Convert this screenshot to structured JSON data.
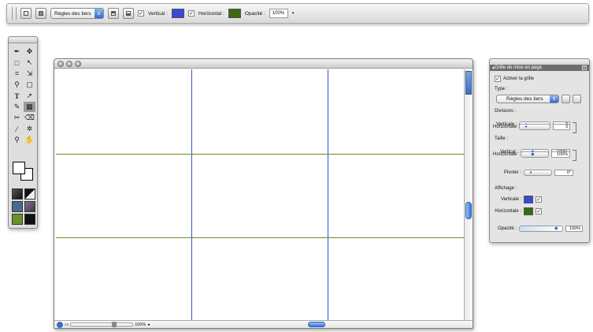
{
  "toolbar": {
    "preset_value": "Règles des tiers",
    "vertical_label": "Vertical :",
    "vertical_checked": true,
    "vertical_color": "#3b48d8",
    "horizontal_label": "Horizontal :",
    "horizontal_checked": true,
    "horizontal_color": "#3a6b12",
    "opacity_label": "Opacité :",
    "opacity_value": "100%"
  },
  "tools": {
    "items": [
      "pen-tool-icon",
      "move-icon",
      "marquee-icon",
      "selection-icon",
      "crop-icon",
      "transform-icon",
      "brush-icon",
      "rect-shape-icon",
      "text-icon",
      "arrow-icon",
      "zoom-blur-icon",
      "gradient-icon",
      "clone-icon",
      "eraser-icon",
      "dropper-icon",
      "hand-wheel-icon",
      "magnify-icon",
      "hand-icon"
    ]
  },
  "document": {
    "zoom_value": "100%",
    "grid_vertical_color": "#3a4fd1",
    "grid_horizontal_color": "#6a8a24"
  },
  "panel": {
    "title": "Grille de mise en page",
    "enable_label": "Activer la grille",
    "enable_checked": true,
    "type_label": "Type :",
    "type_value": "Règles des tiers",
    "divisions_label": "Divisions :",
    "div_vertical_label": "Verticale :",
    "div_vertical_value": "3",
    "div_horizontal_label": "Horizontale :",
    "div_horizontal_value": "3",
    "size_label": "Taille :",
    "size_vertical_label": "Vertical :",
    "size_vertical_value": "100%",
    "size_horizontal_label": "Horizontale :",
    "size_horizontal_value": "100%",
    "rotate_label": "Pivoter :",
    "rotate_value": "0°",
    "display_label": "Affichage :",
    "disp_vertical_label": "Verticale :",
    "disp_vertical_color": "#3b48d8",
    "disp_horizontal_label": "Horizontale :",
    "disp_horizontal_color": "#3a6b12",
    "opacity_label": "Opacité :",
    "opacity_value": "100%"
  }
}
